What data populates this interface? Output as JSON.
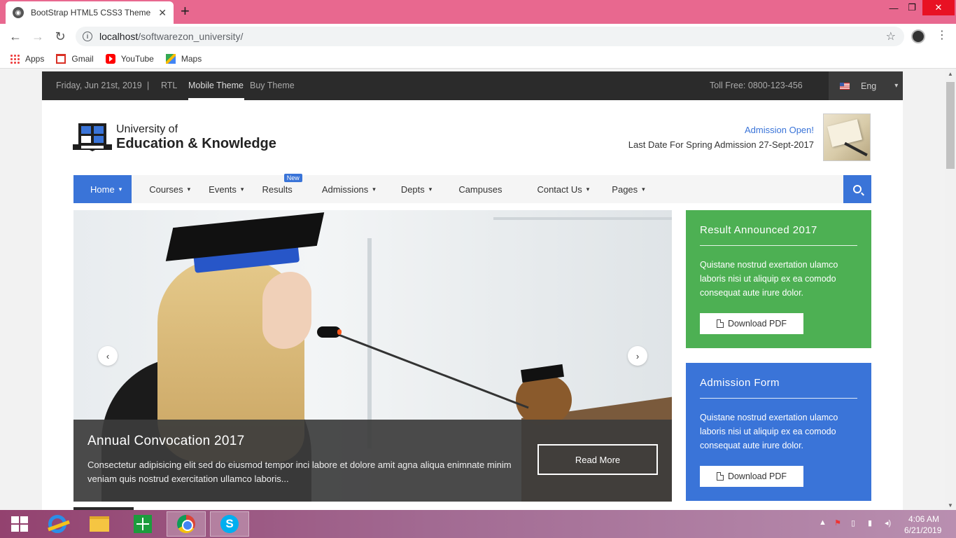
{
  "browser": {
    "tab_title": "BootStrap HTML5 CSS3 Theme",
    "url_host": "localhost",
    "url_path": "/softwarezon_university/",
    "bookmarks": [
      {
        "label": "Apps",
        "icon": "apps-icon"
      },
      {
        "label": "Gmail",
        "icon": "gmail-icon"
      },
      {
        "label": "YouTube",
        "icon": "youtube-icon"
      },
      {
        "label": "Maps",
        "icon": "maps-icon"
      }
    ]
  },
  "topbar": {
    "date": "Friday, Jun 21st, 2019",
    "separator": "|",
    "rtl": "RTL",
    "mobile_theme": "Mobile Theme",
    "buy_theme": "Buy Theme",
    "toll_free": "Toll Free: 0800-123-456",
    "language": "Eng"
  },
  "header": {
    "university_line1": "University of",
    "university_line2": "Education & Knowledge",
    "admission_open": "Admission Open!",
    "last_date": "Last Date For Spring Admission 27-Sept-2017"
  },
  "nav": {
    "items": [
      {
        "label": "Home",
        "dropdown": true,
        "active": true
      },
      {
        "label": "Courses",
        "dropdown": true
      },
      {
        "label": "Events",
        "dropdown": true
      },
      {
        "label": "Results",
        "dropdown": false,
        "badge": "New"
      },
      {
        "label": "Admissions",
        "dropdown": true
      },
      {
        "label": "Depts",
        "dropdown": true
      },
      {
        "label": "Campuses",
        "dropdown": false
      },
      {
        "label": "Contact Us",
        "dropdown": true
      },
      {
        "label": "Pages",
        "dropdown": true
      }
    ],
    "accent_color": "#3a74d8"
  },
  "hero": {
    "title": "Annual Convocation 2017",
    "text": "Consectetur adipisicing elit sed do eiusmod tempor inci labore et dolore amit agna aliqua enimnate minim veniam quis nostrud exercitation ullamco laboris...",
    "button": "Read More"
  },
  "cards": [
    {
      "title": "Result Announced 2017",
      "text": "Quistane nostrud exertation ulamco laboris nisi ut aliquip ex ea comodo consequat aute irure dolor.",
      "button": "Download PDF",
      "color": "#4db053"
    },
    {
      "title": "Admission Form",
      "text": "Quistane nostrud exertation ulamco laboris nisi ut aliquip ex ea comodo consequat aute irure dolor.",
      "button": "Download PDF",
      "color": "#3a74d8"
    }
  ],
  "taskbar": {
    "time": "4:06 AM",
    "date": "6/21/2019"
  }
}
